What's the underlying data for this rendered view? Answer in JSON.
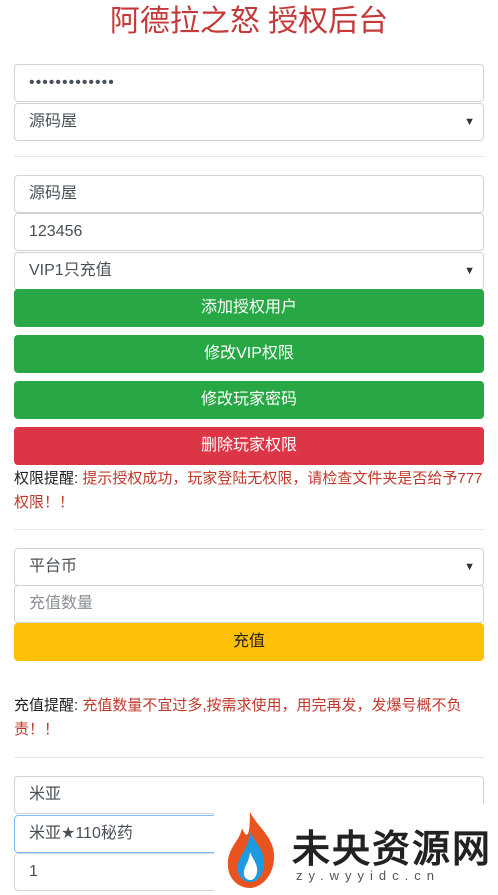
{
  "header": {
    "title": "阿德拉之怒 授权后台"
  },
  "auth_section": {
    "password_value": "•••••••••••••",
    "server_select": "源码屋"
  },
  "user_section": {
    "username_value": "源码屋",
    "password_value": "123456",
    "vip_select": "VIP1只充值",
    "add_button": "添加授权用户",
    "modify_vip_button": "修改VIP权限",
    "modify_password_button": "修改玩家密码",
    "delete_button": "删除玩家权限",
    "notice_label": "权限提醒:",
    "notice_text": "提示授权成功，玩家登陆无权限，请检查文件夹是否给予777权限！！"
  },
  "recharge_section": {
    "currency_select": "平台币",
    "amount_placeholder": "充值数量",
    "recharge_button": "充值",
    "notice_label": "充值提醒:",
    "notice_text": "充值数量不宜过多,按需求使用，用完再发，发爆号概不负责！！"
  },
  "item_section": {
    "player_value": "米亚",
    "item_value": "米亚★110秘药",
    "quantity_value": "1"
  },
  "watermark": {
    "name": "未央资源网",
    "url": "zy.wyyidc.cn"
  },
  "colors": {
    "title": "#c43a3a",
    "green": "#28a745",
    "red": "#dc3545",
    "yellow": "#ffc107",
    "notice": "#c0392b"
  }
}
